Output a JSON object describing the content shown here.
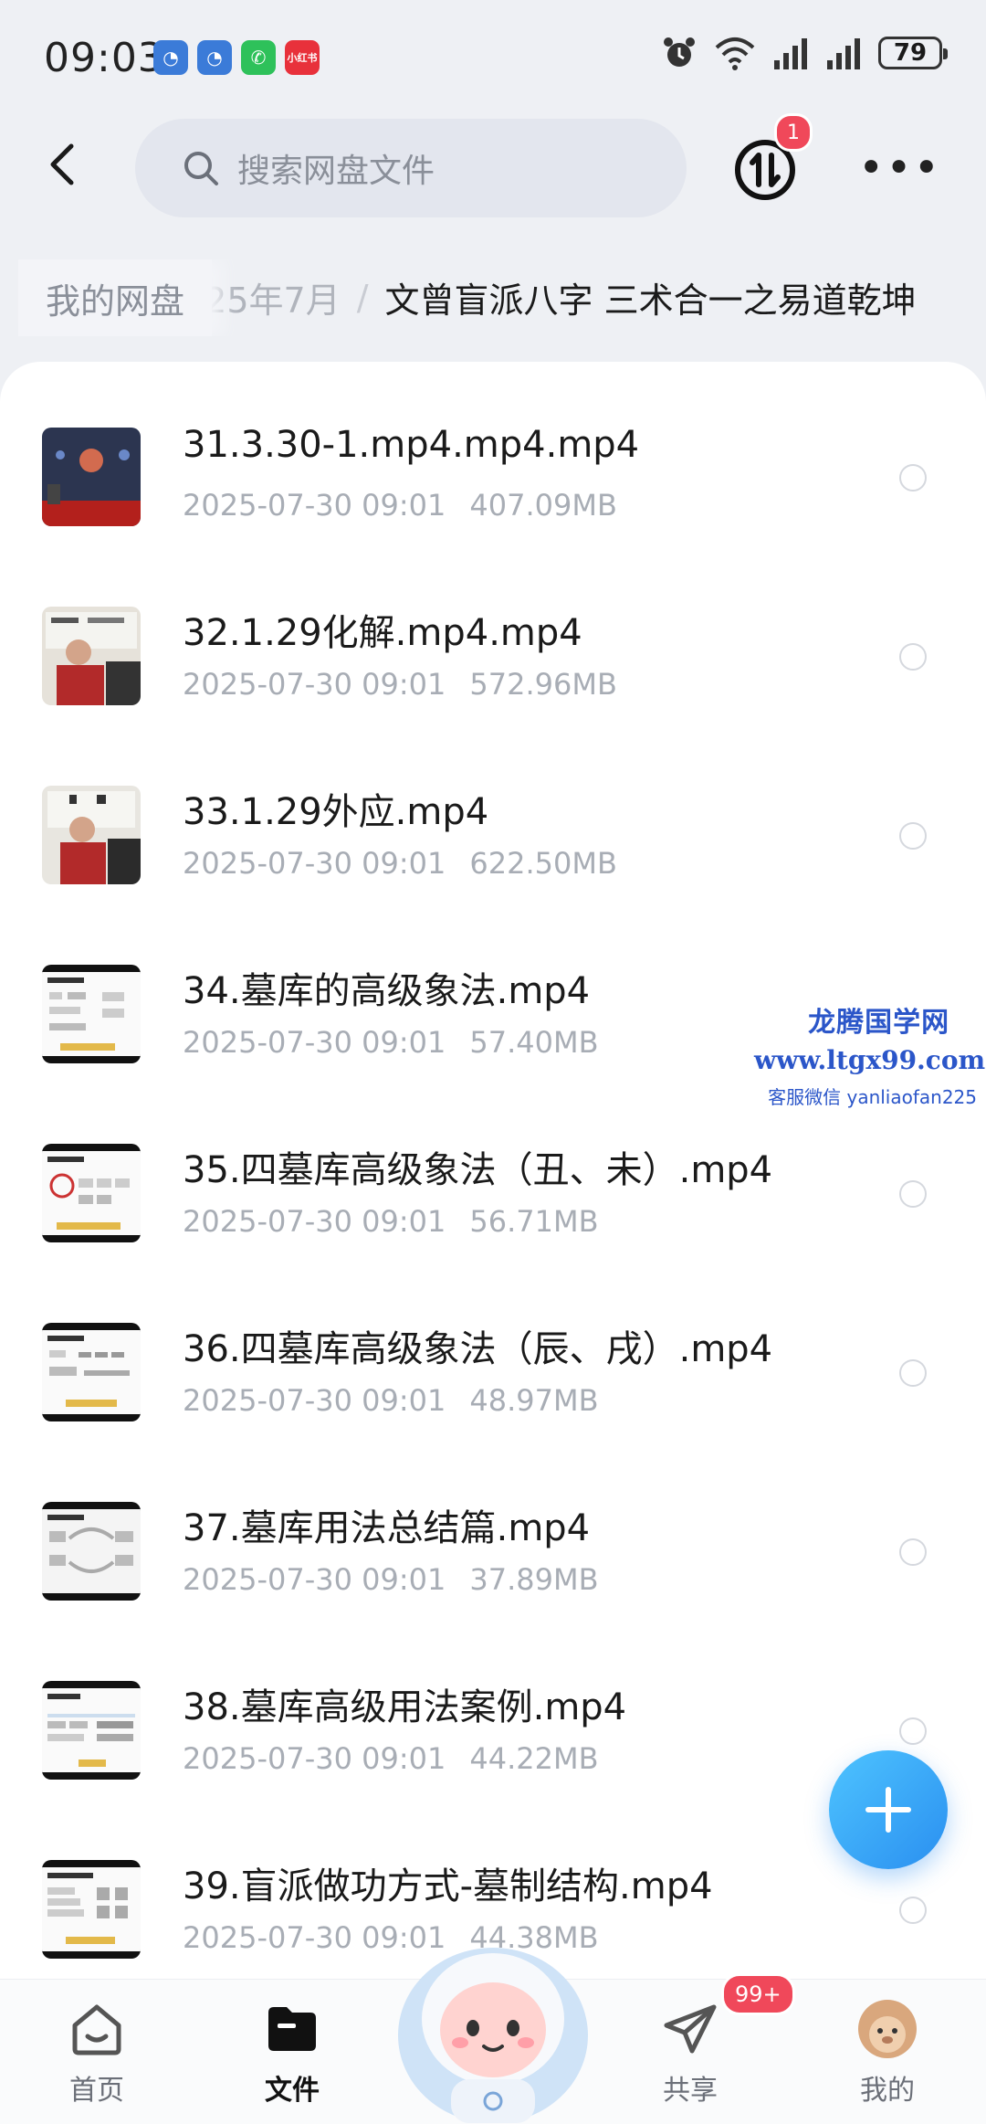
{
  "status_bar": {
    "time": "09:03",
    "notif_app_label": "小红书",
    "battery": "79"
  },
  "header": {
    "search_placeholder": "搜索网盘文件",
    "transfer_badge": "1"
  },
  "breadcrumb": {
    "root": "我的网盘",
    "middle": "025年7月",
    "separator": "/",
    "current": "文曾盲派八字  三术合一之易道乾坤"
  },
  "files": [
    {
      "name": "31.3.30-1.mp4.mp4.mp4",
      "date": "2025-07-30  09:01",
      "size": "407.09MB",
      "thumb": "video-classroom-dark"
    },
    {
      "name": "32.1.29化解.mp4.mp4",
      "date": "2025-07-30  09:01",
      "size": "572.96MB",
      "thumb": "video-lecturer"
    },
    {
      "name": "33.1.29外应.mp4",
      "date": "2025-07-30  09:01",
      "size": "622.50MB",
      "thumb": "video-lecturer"
    },
    {
      "name": "34.墓库的高级象法.mp4",
      "date": "2025-07-30  09:01",
      "size": "57.40MB",
      "thumb": "video-slide"
    },
    {
      "name": "35.四墓库高级象法（丑、未）.mp4",
      "date": "2025-07-30  09:01",
      "size": "56.71MB",
      "thumb": "video-slide"
    },
    {
      "name": "36.四墓库高级象法（辰、戌）.mp4",
      "date": "2025-07-30  09:01",
      "size": "48.97MB",
      "thumb": "video-slide"
    },
    {
      "name": "37.墓库用法总结篇.mp4",
      "date": "2025-07-30  09:01",
      "size": "37.89MB",
      "thumb": "video-slide"
    },
    {
      "name": "38.墓库高级用法案例.mp4",
      "date": "2025-07-30  09:01",
      "size": "44.22MB",
      "thumb": "video-slide"
    },
    {
      "name": "39.盲派做功方式-墓制结构.mp4",
      "date": "2025-07-30  09:01",
      "size": "44.38MB",
      "thumb": "video-slide"
    }
  ],
  "watermark": {
    "title": "龙腾国学网",
    "url": "www.ltgx99.com",
    "contact": "客服微信 yanliaofan225"
  },
  "bottom_nav": {
    "home": "首页",
    "files": "文件",
    "share": "共享",
    "share_badge": "99+",
    "mine": "我的"
  },
  "colors": {
    "accent": "#2a8ff0",
    "badge": "#f0485a",
    "watermark": "#2b56c9"
  }
}
